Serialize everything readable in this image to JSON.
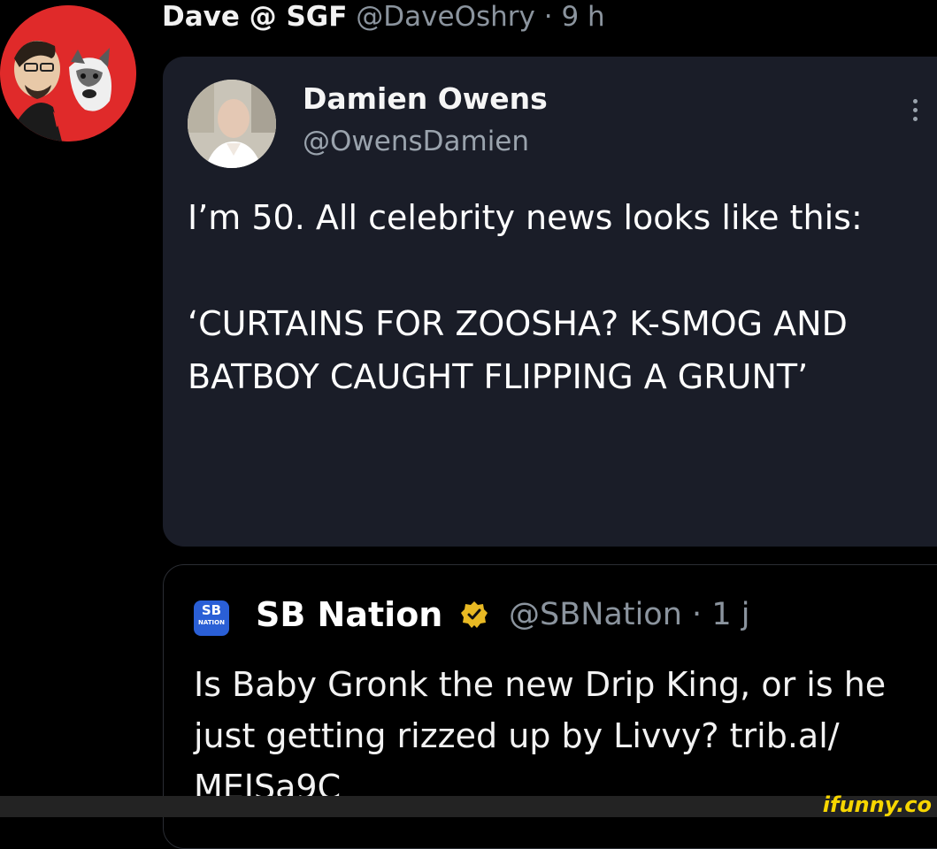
{
  "tweet": {
    "author_name": "Dave @ SGF",
    "author_handle": "@DaveOshry",
    "separator": "·",
    "time": "9 h"
  },
  "quoted": {
    "author_name": "Damien Owens",
    "author_handle": "@OwensDamien",
    "text_line1": "I’m 50. All celebrity news looks like this:",
    "text_line2": "‘CURTAINS FOR ZOOSHA? K-SMOG AND BATBOY CAUGHT FLIPPING A GRUNT’"
  },
  "nested": {
    "logo_text": "SB",
    "logo_sub": "NATION",
    "author_name": "SB Nation",
    "author_handle": "@SBNation",
    "separator": "·",
    "time": "1 j",
    "text": "Is Baby Gronk the new Drip King, or is he just getting rizzed up by Livvy? trib.al/ MEJSa9C"
  },
  "watermark": "ifunny.co",
  "colors": {
    "background": "#000000",
    "card": "#1a1d28",
    "avatar_bg": "#e02a2a",
    "verified": "#e8b923",
    "sb_blue": "#2a5fd6",
    "watermark": "#f7d600"
  },
  "icons": [
    "avatar-dave",
    "avatar-damien",
    "more-icon",
    "sb-nation-logo",
    "verified-badge-icon"
  ]
}
